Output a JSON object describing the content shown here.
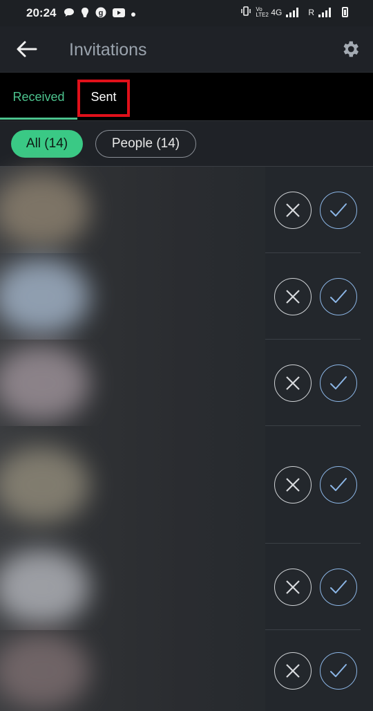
{
  "status_bar": {
    "time": "20:24",
    "notification_icons": [
      "message-icon",
      "shield-icon",
      "g-icon",
      "youtube-icon",
      "dot-icon"
    ],
    "network_label": "4G",
    "volte_label": "Vo LTE2",
    "roaming_label": "R"
  },
  "app_bar": {
    "title": "Invitations",
    "back_icon": "back-arrow-icon",
    "settings_icon": "gear-icon"
  },
  "tabs": [
    {
      "label": "Received",
      "selected": true
    },
    {
      "label": "Sent",
      "selected": false
    }
  ],
  "filters": [
    {
      "label": "All (14)",
      "selected": true
    },
    {
      "label": "People (14)",
      "selected": false
    }
  ],
  "colors": {
    "accent": "#4cc38e",
    "chip_selected": "#3ac985",
    "highlight_box": "#e0101a",
    "accept_ring": "#8cb6e6"
  },
  "invitations": [
    {
      "avatar_tone": "#8a7f6e",
      "decline_icon": "close-icon",
      "accept_icon": "check-icon"
    },
    {
      "avatar_tone": "#9fb0c4",
      "decline_icon": "close-icon",
      "accept_icon": "check-icon"
    },
    {
      "avatar_tone": "#9a8f96",
      "decline_icon": "close-icon",
      "accept_icon": "check-icon"
    },
    {
      "avatar_tone": "#8e8878",
      "decline_icon": "close-icon",
      "accept_icon": "check-icon"
    },
    {
      "avatar_tone": "#aeb0b6",
      "decline_icon": "close-icon",
      "accept_icon": "check-icon"
    },
    {
      "avatar_tone": "#7a6c6e",
      "decline_icon": "close-icon",
      "accept_icon": "check-icon"
    }
  ]
}
